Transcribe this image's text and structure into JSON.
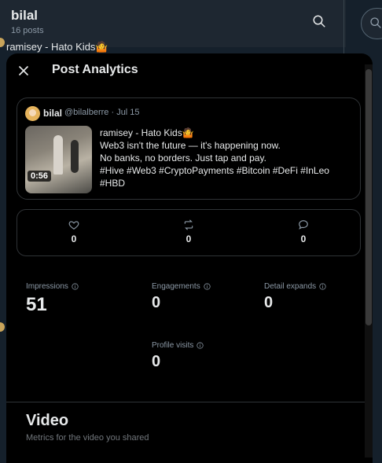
{
  "background": {
    "profile_name": "bilal",
    "post_count": "16 posts",
    "peek_text": "ramisey - Hato Kids🤷"
  },
  "modal": {
    "title": "Post Analytics",
    "post": {
      "author_name": "bilal",
      "handle_date": "@bilalberre · Jul 15",
      "video_duration": "0:56",
      "lines": [
        "ramisey - Hato Kids🤷",
        "Web3 isn't the future — it's happening now.",
        "No banks, no borders. Just tap and pay.",
        "#Hive #Web3 #CryptoPayments #Bitcoin #DeFi #InLeo",
        "#HBD"
      ]
    },
    "engagement": {
      "likes": "0",
      "reposts": "0",
      "replies": "0"
    },
    "metrics": {
      "impressions_label": "Impressions",
      "impressions_value": "51",
      "engagements_label": "Engagements",
      "engagements_value": "0",
      "detail_expands_label": "Detail expands",
      "detail_expands_value": "0",
      "profile_visits_label": "Profile visits",
      "profile_visits_value": "0"
    },
    "video_section": {
      "title": "Video",
      "subtitle": "Metrics for the video you shared"
    }
  }
}
